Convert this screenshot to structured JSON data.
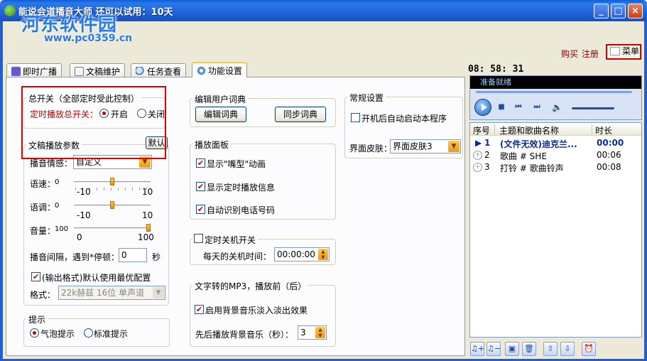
{
  "window": {
    "title": "能说会道播音大师   还可以试用：10天",
    "watermark": "河东软件园",
    "watermark_url": "www.pc0359.cn",
    "buttons": {
      "minimize": "_",
      "maximize": "□",
      "close": "×"
    }
  },
  "top_links": {
    "buy": "购买",
    "register": "注册",
    "menu": "菜单"
  },
  "tabs": [
    {
      "label": "即时广播",
      "icon": "broadcast-icon"
    },
    {
      "label": "文稿维护",
      "icon": "document-icon"
    },
    {
      "label": "任务查看",
      "icon": "magnifier-icon"
    },
    {
      "label": "功能设置",
      "icon": "gear-icon",
      "active": true
    }
  ],
  "master_switch": {
    "legend": "总开关（全部定时受此控制）",
    "label": "定时播放总开关：",
    "on_label": "开启",
    "off_label": "关闭",
    "selected": "on"
  },
  "playback_params": {
    "legend": "文稿播放参数",
    "default_button": "默认",
    "emotion_label": "播音情感：",
    "emotion_value": "自定义",
    "speed": {
      "label": "语速：",
      "value": "0",
      "min": "-10",
      "max": "10",
      "level": 0.5
    },
    "pitch": {
      "label": "语调：",
      "value": "0",
      "min": "-10",
      "max": "10",
      "level": 0.5
    },
    "volume": {
      "label": "音量：",
      "value": "100",
      "min": "0",
      "max": "100",
      "level": 1.0
    },
    "interval_label": "播音间隔，遇到*停顿：",
    "interval_value": "0",
    "interval_unit": "秒",
    "output_format_checkbox": "(输出格式)默认使用最优配置",
    "output_format_checked": true,
    "format_label": "格式：",
    "format_value": "22k赫兹 16位 单声道"
  },
  "tips": {
    "legend": "提示",
    "bubble_label": "气泡提示",
    "standard_label": "标准提示",
    "selected": "bubble"
  },
  "dictionary": {
    "legend": "编辑用户词典",
    "edit_button": "编辑词典",
    "sync_button": "同步词典"
  },
  "play_panel": {
    "legend": "播放面板",
    "options": [
      {
        "label": "显示\"嘴型\"动画",
        "checked": true
      },
      {
        "label": "显示定时播放信息",
        "checked": true
      },
      {
        "label": "自动识别电话号码",
        "checked": true
      }
    ]
  },
  "shutdown": {
    "legend": "定时关机开关",
    "checked": false,
    "label": "每天的关机时间：",
    "time": "00:00:00"
  },
  "mp3": {
    "legend": "文字转的MP3，播放前（后）",
    "fade_label": "启用背景音乐淡入淡出效果",
    "fade_checked": true,
    "bg_label": "先后播放背景音乐（秒）：",
    "bg_value": "3"
  },
  "general": {
    "legend": "常规设置",
    "autostart_label": "开机后自动启动本程序",
    "autostart_checked": false,
    "skin_label": "界面皮肤：",
    "skin_value": "界面皮肤3"
  },
  "clock": "08: 58: 31",
  "player": {
    "status": "准备就绪",
    "columns": [
      "序号",
      "主题和歌曲名称",
      "时长"
    ],
    "rows": [
      {
        "index": "1",
        "title": "(文件无效)迪克兰...",
        "duration": "00:00",
        "current": true
      },
      {
        "index": "2",
        "title": "歌曲 # SHE",
        "duration": "00:06",
        "current": false
      },
      {
        "index": "3",
        "title": "打铃 # 歌曲铃声",
        "duration": "00:08",
        "current": false
      }
    ]
  },
  "colors": {
    "accent_red": "#c00000",
    "selection_box": "#e00000",
    "title_blue": "#1f64d8"
  }
}
